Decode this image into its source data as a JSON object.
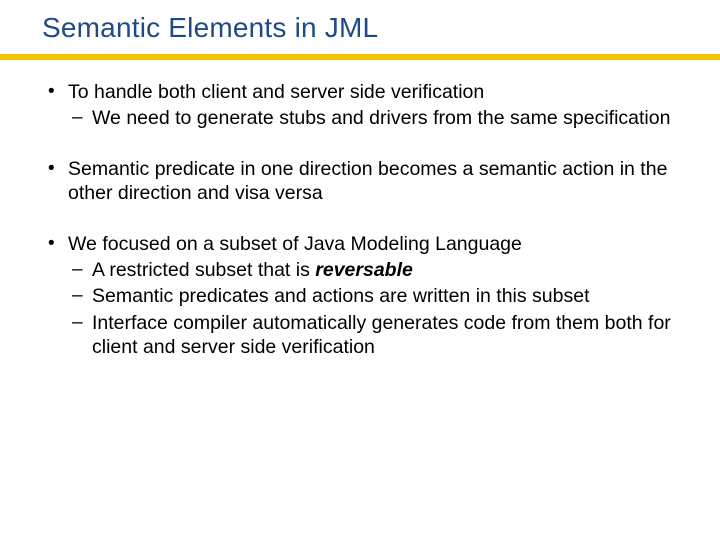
{
  "title": "Semantic Elements in JML",
  "b1": "To handle both client and server side verification",
  "b1s1": "We need to generate stubs and drivers from the same specification",
  "b2": "Semantic predicate in one direction becomes a semantic action in the other direction and visa versa",
  "b3": "We focused on a subset of Java Modeling Language",
  "b3s1a": "A restricted subset that is ",
  "b3s1b": "reversable",
  "b3s2": "Semantic predicates and actions are written in this subset",
  "b3s3": "Interface compiler automatically generates code from them both for client and server side verification"
}
